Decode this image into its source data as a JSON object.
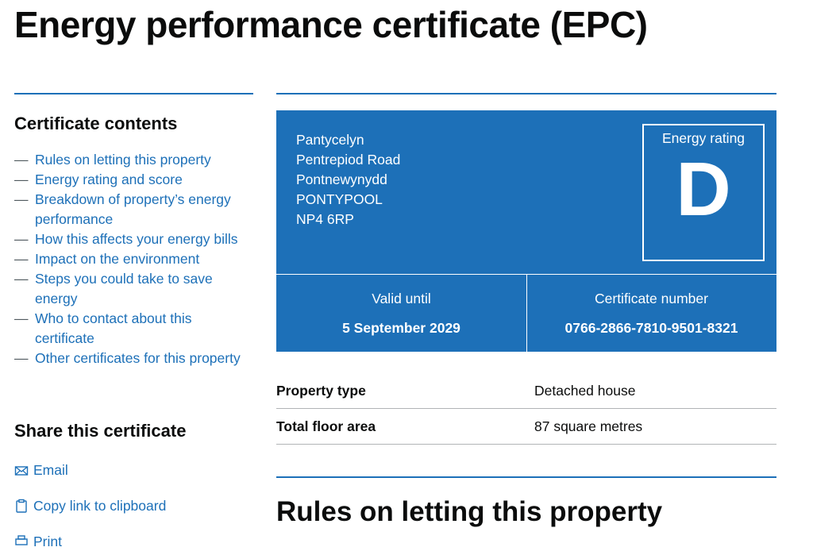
{
  "page": {
    "title": "Energy performance certificate (EPC)"
  },
  "sidebar": {
    "heading": "Certificate contents",
    "items": [
      {
        "label": "Rules on letting this property"
      },
      {
        "label": "Energy rating and score"
      },
      {
        "label": "Breakdown of property’s energy performance"
      },
      {
        "label": "How this affects your energy bills"
      },
      {
        "label": "Impact on the environment"
      },
      {
        "label": "Steps you could take to save energy"
      },
      {
        "label": "Who to contact about this certificate"
      },
      {
        "label": "Other certificates for this property"
      }
    ],
    "share_heading": "Share this certificate",
    "share": {
      "email": "Email",
      "copy": "Copy link to clipboard",
      "print": "Print"
    }
  },
  "certificate": {
    "address": [
      "Pantycelyn",
      "Pentrepiod Road",
      "Pontnewynydd",
      "PONTYPOOL",
      "NP4 6RP"
    ],
    "rating_label": "Energy rating",
    "rating": "D",
    "valid_label": "Valid until",
    "valid_value": "5 September 2029",
    "number_label": "Certificate number",
    "number_value": "0766-2866-7810-9501-8321"
  },
  "summary": {
    "property_type_label": "Property type",
    "property_type_value": "Detached house",
    "floor_area_label": "Total floor area",
    "floor_area_value": "87 square metres"
  },
  "section": {
    "rules_heading": "Rules on letting this property"
  },
  "colors": {
    "brand_blue": "#1d70b8",
    "text": "#0b0c0c",
    "border": "#b1b4b6"
  }
}
